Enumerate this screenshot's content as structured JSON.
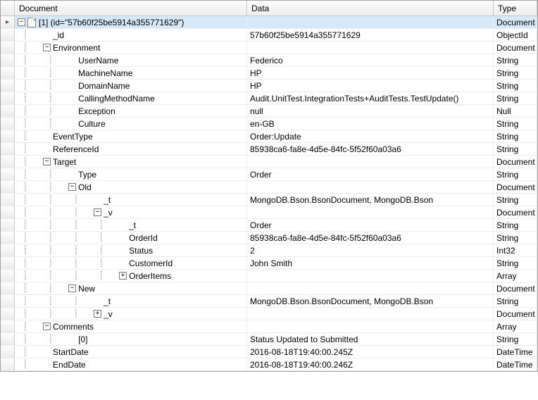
{
  "headers": {
    "document": "Document",
    "data": "Data",
    "type": "Type"
  },
  "rows": [
    {
      "prefix": "",
      "toggle": "-",
      "icon": true,
      "label": "[1] (id=\"57b60f25be5914a355771629\")",
      "data": "",
      "type": "Document",
      "selected": true,
      "indent": 0,
      "gutter": "▸"
    },
    {
      "prefix": "   ",
      "toggle": "",
      "icon": false,
      "label": "_id",
      "data": "57b60f25be5914a355771629",
      "type": "ObjectId",
      "indent": 1
    },
    {
      "prefix": "   ",
      "toggle": "-",
      "icon": false,
      "label": "Environment",
      "data": "",
      "type": "Document",
      "indent": 1
    },
    {
      "prefix": "       ",
      "toggle": "",
      "icon": false,
      "label": "UserName",
      "data": "Federico",
      "type": "String",
      "indent": 2
    },
    {
      "prefix": "       ",
      "toggle": "",
      "icon": false,
      "label": "MachineName",
      "data": "HP",
      "type": "String",
      "indent": 2
    },
    {
      "prefix": "       ",
      "toggle": "",
      "icon": false,
      "label": "DomainName",
      "data": "HP",
      "type": "String",
      "indent": 2
    },
    {
      "prefix": "       ",
      "toggle": "",
      "icon": false,
      "label": "CallingMethodName",
      "data": "Audit.UnitTest.IntegrationTests+AuditTests.TestUpdate()",
      "type": "String",
      "indent": 2
    },
    {
      "prefix": "       ",
      "toggle": "",
      "icon": false,
      "label": "Exception",
      "data": "null",
      "type": "Null",
      "indent": 2
    },
    {
      "prefix": "       ",
      "toggle": "",
      "icon": false,
      "label": "Culture",
      "data": "en-GB",
      "type": "String",
      "indent": 2
    },
    {
      "prefix": "   ",
      "toggle": "",
      "icon": false,
      "label": "EventType",
      "data": "Order:Update",
      "type": "String",
      "indent": 1
    },
    {
      "prefix": "   ",
      "toggle": "",
      "icon": false,
      "label": "ReferenceId",
      "data": "85938ca6-fa8e-4d5e-84fc-5f52f60a03a6",
      "type": "String",
      "indent": 1
    },
    {
      "prefix": "   ",
      "toggle": "-",
      "icon": false,
      "label": "Target",
      "data": "",
      "type": "Document",
      "indent": 1
    },
    {
      "prefix": "       ",
      "toggle": "",
      "icon": false,
      "label": "Type",
      "data": "Order",
      "type": "String",
      "indent": 2
    },
    {
      "prefix": "       ",
      "toggle": "-",
      "icon": false,
      "label": "Old",
      "data": "",
      "type": "Document",
      "indent": 2
    },
    {
      "prefix": "           ",
      "toggle": "",
      "icon": false,
      "label": "_t",
      "data": "MongoDB.Bson.BsonDocument, MongoDB.Bson",
      "type": "String",
      "indent": 3
    },
    {
      "prefix": "           ",
      "toggle": "-",
      "icon": false,
      "label": "_v",
      "data": "",
      "type": "Document",
      "indent": 3
    },
    {
      "prefix": "               ",
      "toggle": "",
      "icon": false,
      "label": "_t",
      "data": "Order",
      "type": "String",
      "indent": 4
    },
    {
      "prefix": "               ",
      "toggle": "",
      "icon": false,
      "label": "OrderId",
      "data": "85938ca6-fa8e-4d5e-84fc-5f52f60a03a6",
      "type": "String",
      "indent": 4
    },
    {
      "prefix": "               ",
      "toggle": "",
      "icon": false,
      "label": "Status",
      "data": "2",
      "type": "Int32",
      "indent": 4
    },
    {
      "prefix": "               ",
      "toggle": "",
      "icon": false,
      "label": "CustomerId",
      "data": "John Smith",
      "type": "String",
      "indent": 4
    },
    {
      "prefix": "               ",
      "toggle": "+",
      "icon": false,
      "label": "OrderItems",
      "data": "",
      "type": "Array",
      "indent": 4
    },
    {
      "prefix": "       ",
      "toggle": "-",
      "icon": false,
      "label": "New",
      "data": "",
      "type": "Document",
      "indent": 2
    },
    {
      "prefix": "           ",
      "toggle": "",
      "icon": false,
      "label": "_t",
      "data": "MongoDB.Bson.BsonDocument, MongoDB.Bson",
      "type": "String",
      "indent": 3
    },
    {
      "prefix": "           ",
      "toggle": "+",
      "icon": false,
      "label": "_v",
      "data": "",
      "type": "Document",
      "indent": 3
    },
    {
      "prefix": "   ",
      "toggle": "-",
      "icon": false,
      "label": "Comments",
      "data": "",
      "type": "Array",
      "indent": 1
    },
    {
      "prefix": "       ",
      "toggle": "",
      "icon": false,
      "label": "[0]",
      "data": "Status Updated to Submitted",
      "type": "String",
      "indent": 2
    },
    {
      "prefix": "   ",
      "toggle": "",
      "icon": false,
      "label": "StartDate",
      "data": "2016-08-18T19:40:00.245Z",
      "type": "DateTime",
      "indent": 1
    },
    {
      "prefix": "   ",
      "toggle": "",
      "icon": false,
      "label": "EndDate",
      "data": "2016-08-18T19:40:00.246Z",
      "type": "DateTime",
      "indent": 1
    }
  ]
}
